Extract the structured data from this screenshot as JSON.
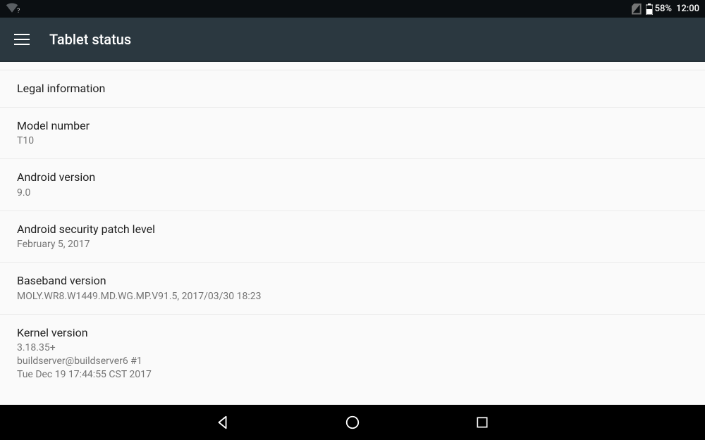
{
  "statusbar": {
    "battery_pct": "58%",
    "clock": "12:00"
  },
  "appbar": {
    "title": "Tablet status"
  },
  "items": [
    {
      "title": "Legal information",
      "sub": ""
    },
    {
      "title": "Model number",
      "sub": "T10"
    },
    {
      "title": "Android version",
      "sub": "9.0"
    },
    {
      "title": "Android security patch level",
      "sub": "February 5, 2017"
    },
    {
      "title": "Baseband version",
      "sub": "MOLY.WR8.W1449.MD.WG.MP.V91.5, 2017/03/30 18:23"
    },
    {
      "title": "Kernel version",
      "sub": "3.18.35+\nbuildserver@buildserver6 #1\nTue Dec 19 17:44:55 CST 2017"
    }
  ]
}
